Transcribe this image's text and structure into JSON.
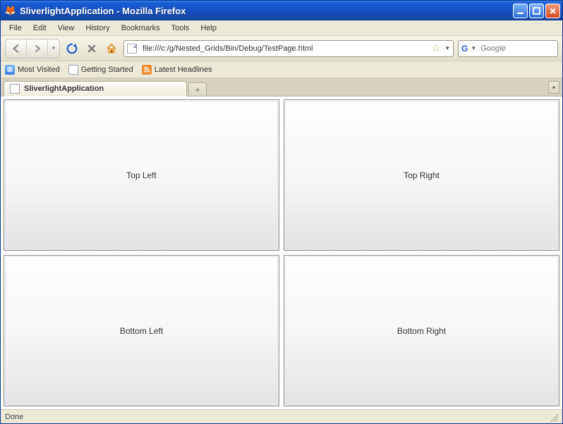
{
  "window": {
    "title": "SliverlightApplication - Mozilla Firefox"
  },
  "menu": {
    "file": "File",
    "edit": "Edit",
    "view": "View",
    "history": "History",
    "bookmarks": "Bookmarks",
    "tools": "Tools",
    "help": "Help"
  },
  "nav": {
    "url": "file:///c:/g/Nested_Grids/Bin/Debug/TestPage.html",
    "search_placeholder": "Google"
  },
  "bookmarks": {
    "most_visited": "Most Visited",
    "getting_started": "Getting Started",
    "latest_headlines": "Latest Headlines"
  },
  "tabs": {
    "active": "SliverlightApplication",
    "newtab_symbol": "+"
  },
  "grid": {
    "top_left": "Top Left",
    "top_right": "Top Right",
    "bottom_left": "Bottom Left",
    "bottom_right": "Bottom Right"
  },
  "status": {
    "text": "Done"
  }
}
